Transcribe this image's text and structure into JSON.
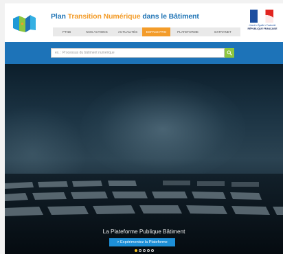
{
  "header": {
    "title_part1": "Plan ",
    "title_part2": "Transition Numérique",
    "title_part3": " dans le Bâtiment",
    "logo_icon": "ptnb-building-blocks-logo",
    "flag_icon": "french-republic-flag",
    "motto": "Liberté • Égalité • Fraternité",
    "republic_label": "RÉPUBLIQUE FRANÇAISE"
  },
  "nav": {
    "items": [
      {
        "label": "PTNB",
        "active": false
      },
      {
        "label": "NOS ACTIONS",
        "active": false
      },
      {
        "label": "ACTUALITÉS",
        "active": false
      },
      {
        "label": "ESPACE PRO",
        "active": true
      },
      {
        "label": "PLATEFORME",
        "active": false
      },
      {
        "label": "EXTRANET",
        "active": false
      }
    ]
  },
  "search": {
    "placeholder": "ex. : Processus du bâtiment numérique",
    "button_icon": "search-icon"
  },
  "hero": {
    "caption": "La Plateforme Publique Bâtiment",
    "cta_label": "> Expérimentez la Plateforme",
    "slide_count": 5,
    "active_slide": 1
  },
  "colors": {
    "brand_blue": "#1f74b5",
    "brand_orange": "#f39c2a",
    "search_band": "#1d73b8",
    "search_button": "#8dc63f",
    "cta": "#1d8fd8",
    "active_dot": "#f4c01e"
  }
}
